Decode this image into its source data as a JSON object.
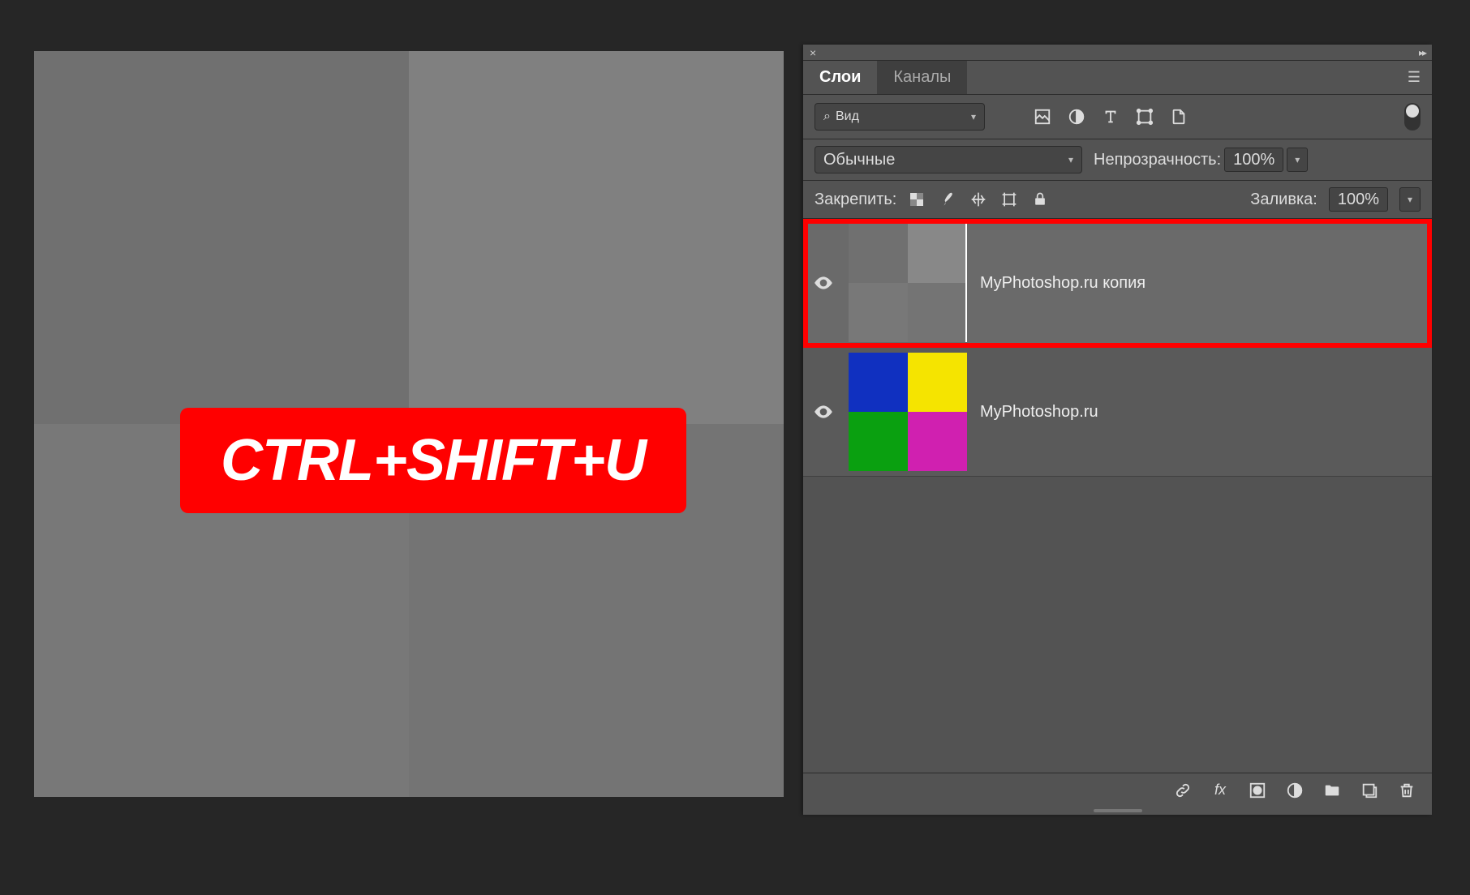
{
  "canvas": {
    "shortcut_text": "CTRL+SHIFT+U"
  },
  "panel": {
    "tabs": {
      "layers": "Слои",
      "channels": "Каналы"
    },
    "kind_filter": "Вид",
    "blend_mode": "Обычные",
    "opacity_label": "Непрозрачность:",
    "opacity_value": "100%",
    "lock_label": "Закрепить:",
    "fill_label": "Заливка:",
    "fill_value": "100%",
    "layers": [
      {
        "name": "MyPhotoshop.ru копия",
        "selected": true,
        "grayscale": true
      },
      {
        "name": "MyPhotoshop.ru",
        "selected": false,
        "grayscale": false
      }
    ]
  }
}
